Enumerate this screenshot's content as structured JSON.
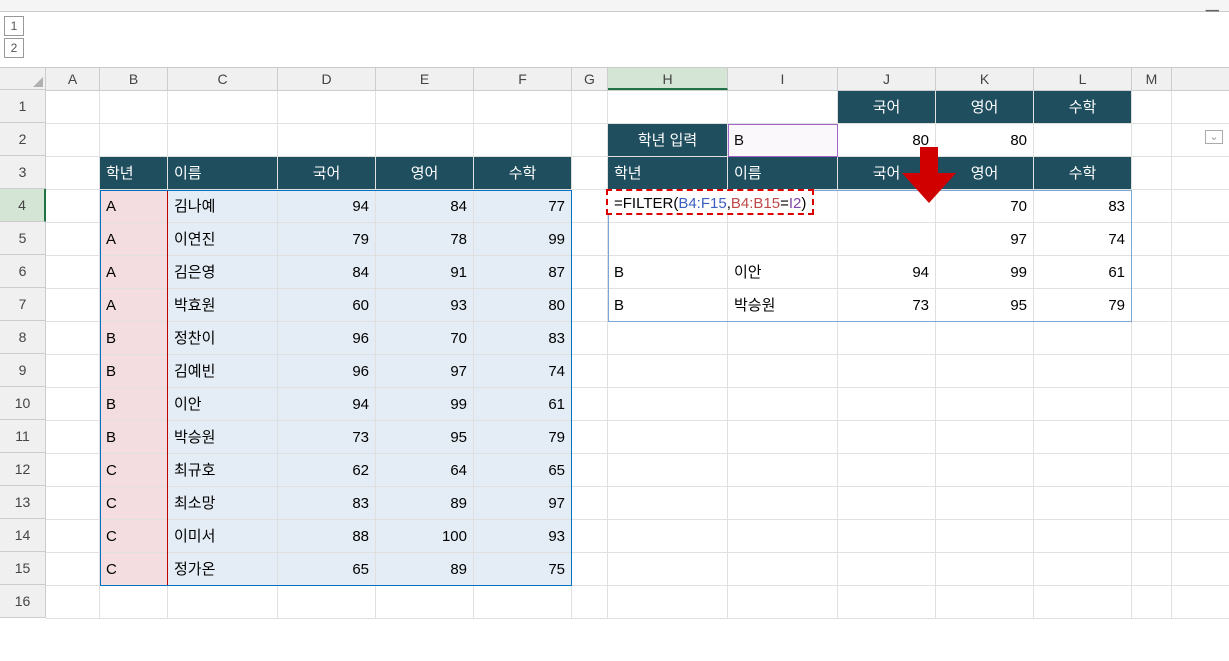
{
  "columns": [
    "A",
    "B",
    "C",
    "D",
    "E",
    "F",
    "G",
    "H",
    "I",
    "J",
    "K",
    "L",
    "M"
  ],
  "rows": [
    1,
    2,
    3,
    4,
    5,
    6,
    7,
    8,
    9,
    10,
    11,
    12,
    13,
    14,
    15,
    16
  ],
  "outline": {
    "level1": "1",
    "level2": "2"
  },
  "left_table": {
    "header": {
      "grade": "학년",
      "name": "이름",
      "kor": "국어",
      "eng": "영어",
      "math": "수학"
    },
    "rows": [
      {
        "grade": "A",
        "name": "김나예",
        "kor": 94,
        "eng": 84,
        "math": 77
      },
      {
        "grade": "A",
        "name": "이연진",
        "kor": 79,
        "eng": 78,
        "math": 99
      },
      {
        "grade": "A",
        "name": "김은영",
        "kor": 84,
        "eng": 91,
        "math": 87
      },
      {
        "grade": "A",
        "name": "박효원",
        "kor": 60,
        "eng": 93,
        "math": 80
      },
      {
        "grade": "B",
        "name": "정찬이",
        "kor": 96,
        "eng": 70,
        "math": 83
      },
      {
        "grade": "B",
        "name": "김예빈",
        "kor": 96,
        "eng": 97,
        "math": 74
      },
      {
        "grade": "B",
        "name": "이안",
        "kor": 94,
        "eng": 99,
        "math": 61
      },
      {
        "grade": "B",
        "name": "박승원",
        "kor": 73,
        "eng": 95,
        "math": 79
      },
      {
        "grade": "C",
        "name": "최규호",
        "kor": 62,
        "eng": 64,
        "math": 65
      },
      {
        "grade": "C",
        "name": "최소망",
        "kor": 83,
        "eng": 89,
        "math": 97
      },
      {
        "grade": "C",
        "name": "이미서",
        "kor": 88,
        "eng": 100,
        "math": 93
      },
      {
        "grade": "C",
        "name": "정가온",
        "kor": 65,
        "eng": 89,
        "math": 75
      }
    ]
  },
  "right_panel": {
    "subject_header": {
      "kor": "국어",
      "eng": "영어",
      "math": "수학"
    },
    "input_label": "학년 입력",
    "input_value": "B",
    "summary": {
      "kor": 80,
      "eng": 80,
      "math": ""
    },
    "result_header": {
      "grade": "학년",
      "name": "이름",
      "kor": "국어",
      "eng": "영어",
      "math": "수학"
    },
    "formula": {
      "eq": "=",
      "fn": "FILTER(",
      "arg1": "B4:F15",
      "comma1": ",",
      "arg2": "B4:B15",
      "op": "=",
      "arg3": "I2",
      "close": ")"
    },
    "spill": [
      {
        "grade": "",
        "name": "",
        "kor": "",
        "eng": 70,
        "math": 83
      },
      {
        "grade": "",
        "name": "",
        "kor": "",
        "eng": 97,
        "math": 74
      },
      {
        "grade": "B",
        "name": "이안",
        "kor": 94,
        "eng": 99,
        "math": 61
      },
      {
        "grade": "B",
        "name": "박승원",
        "kor": 73,
        "eng": 95,
        "math": 79
      }
    ]
  }
}
